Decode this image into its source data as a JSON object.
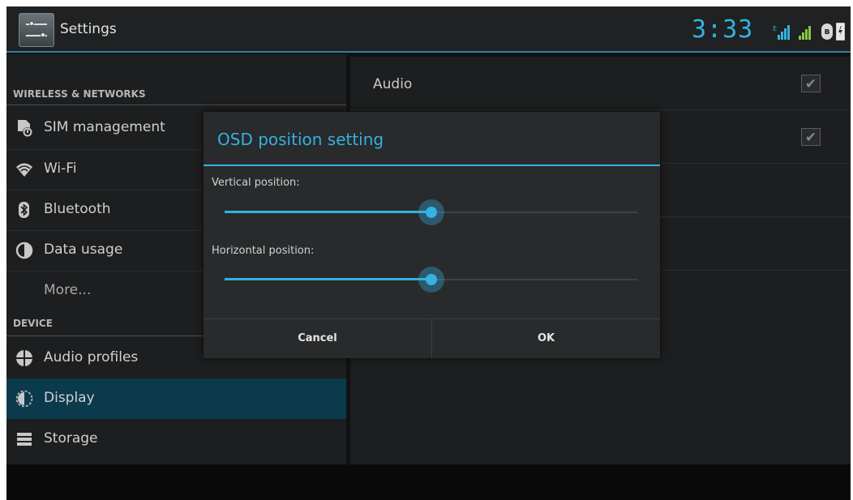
{
  "status_bar": {
    "app_title": "Settings",
    "clock": "3:33",
    "icons": [
      "settings-app-icon",
      "signal-e-icon",
      "signal-icon",
      "bluetooth-status-icon",
      "battery-charging-icon"
    ]
  },
  "sidebar": {
    "section_wireless": "WIRELESS & NETWORKS",
    "section_device": "DEVICE",
    "items": [
      {
        "label": "SIM management",
        "icon": "sim-icon"
      },
      {
        "label": "Wi-Fi",
        "icon": "wifi-icon"
      },
      {
        "label": "Bluetooth",
        "icon": "bluetooth-icon"
      },
      {
        "label": "Data usage",
        "icon": "data-usage-icon"
      },
      {
        "label": "More...",
        "icon": ""
      },
      {
        "label": "Audio profiles",
        "icon": "audio-profiles-icon"
      },
      {
        "label": "Display",
        "icon": "display-icon",
        "selected": true
      },
      {
        "label": "Storage",
        "icon": "storage-icon"
      }
    ]
  },
  "detail": {
    "rows": [
      {
        "label": "Audio",
        "checked": true
      },
      {
        "label": "",
        "checked": true
      }
    ]
  },
  "dialog": {
    "title": "OSD position setting",
    "vertical_label": "Vertical position:",
    "vertical_value": 0.5,
    "horizontal_label": "Horizontal position:",
    "horizontal_value": 0.5,
    "cancel_label": "Cancel",
    "ok_label": "OK"
  },
  "colors": {
    "accent": "#35b1e2",
    "selected_bg": "#0b3a4c",
    "background": "#1d1e1f"
  }
}
